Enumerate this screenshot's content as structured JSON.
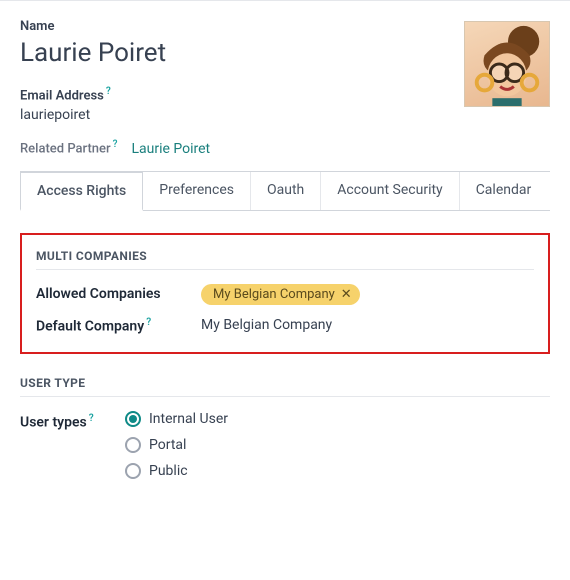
{
  "name": {
    "label": "Name",
    "value": "Laurie Poiret"
  },
  "email": {
    "label": "Email Address",
    "value": "lauriepoiret"
  },
  "relatedPartner": {
    "label": "Related Partner",
    "link": "Laurie Poiret"
  },
  "tabs": [
    {
      "label": "Access Rights",
      "active": true
    },
    {
      "label": "Preferences",
      "active": false
    },
    {
      "label": "Oauth",
      "active": false
    },
    {
      "label": "Account Security",
      "active": false
    },
    {
      "label": "Calendar",
      "active": false
    }
  ],
  "multiCompanies": {
    "title": "MULTI COMPANIES",
    "allowed": {
      "label": "Allowed Companies",
      "tags": [
        "My Belgian Company"
      ]
    },
    "default": {
      "label": "Default Company",
      "value": "My Belgian Company"
    }
  },
  "userType": {
    "title": "USER TYPE",
    "label": "User types",
    "options": [
      {
        "label": "Internal User",
        "checked": true
      },
      {
        "label": "Portal",
        "checked": false
      },
      {
        "label": "Public",
        "checked": false
      }
    ]
  },
  "helpGlyph": "?"
}
